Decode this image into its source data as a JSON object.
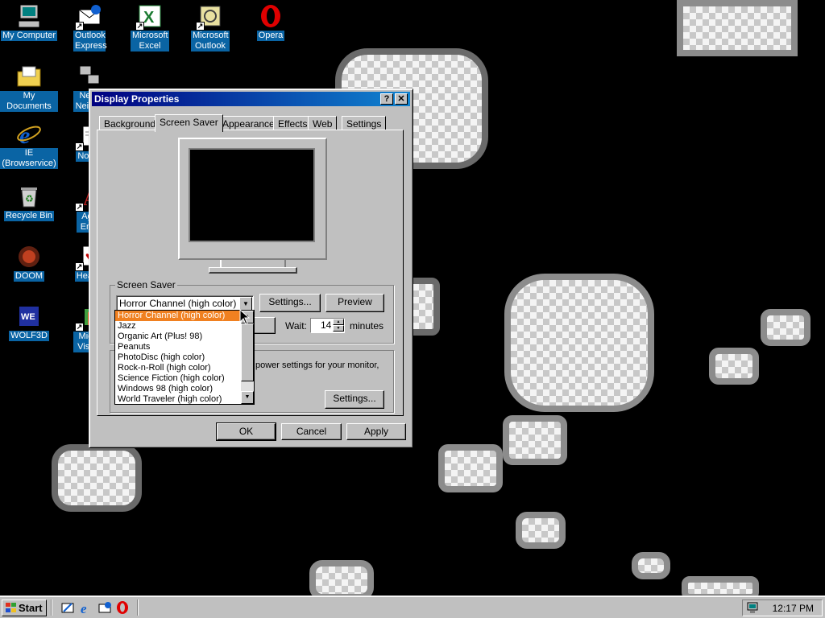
{
  "desktop": {
    "icons": [
      {
        "label": "My Computer",
        "icon": "my-computer-icon"
      },
      {
        "label": "Outlook Express",
        "icon": "outlook-express-icon"
      },
      {
        "label": "Microsoft Excel",
        "icon": "excel-icon"
      },
      {
        "label": "Microsoft Outlook",
        "icon": "outlook-icon"
      },
      {
        "label": "Opera",
        "icon": "opera-icon"
      },
      {
        "label": "My Documents",
        "icon": "my-documents-icon"
      },
      {
        "label": "Netw Neighb",
        "icon": "network-neighborhood-icon"
      },
      {
        "label": "IE (Browservice)",
        "icon": "internet-explorer-icon"
      },
      {
        "label": "Notep",
        "icon": "notepad-icon"
      },
      {
        "label": "Recycle Bin",
        "icon": "recycle-bin-icon"
      },
      {
        "label": "Age Emp",
        "icon": "age-of-empires-icon"
      },
      {
        "label": "DOOM",
        "icon": "doom-icon"
      },
      {
        "label": "Hearts",
        "icon": "hearts-icon"
      },
      {
        "label": "WOLF3D",
        "icon": "wolf3d-icon"
      },
      {
        "label": "Micro Visual",
        "icon": "visual-studio-icon"
      }
    ]
  },
  "dialog": {
    "title": "Display Properties",
    "help_button": "?",
    "close_button": "✕",
    "tabs": [
      "Background",
      "Screen Saver",
      "Appearance",
      "Effects",
      "Web",
      "Settings"
    ],
    "active_tab": "Screen Saver",
    "screen_saver": {
      "group_label": "Screen Saver",
      "selected": "Horror Channel (high color)",
      "settings_button": "Settings...",
      "preview_button": "Preview",
      "wait_label": "Wait:",
      "wait_value": "14",
      "wait_unit": "minutes",
      "dropdown_options": [
        "Horror Channel (high color)",
        "Jazz",
        "Organic Art (Plus! 98)",
        "Peanuts",
        "PhotoDisc (high color)",
        "Rock-n-Roll (high color)",
        "Science Fiction (high color)",
        "Windows 98 (high color)",
        "World Traveler (high color)"
      ],
      "highlighted_option_index": 0
    },
    "energy": {
      "text": "power settings for your monitor,",
      "settings_button": "Settings..."
    },
    "ok_button": "OK",
    "cancel_button": "Cancel",
    "apply_button": "Apply"
  },
  "taskbar": {
    "start_label": "Start",
    "quick_launch": [
      "show-desktop-icon",
      "internet-explorer-icon",
      "outlook-express-icon",
      "opera-icon"
    ],
    "clock": "12:17 PM"
  },
  "colors": {
    "title_bar": "#000080",
    "selection": "#f08020",
    "desktop_label": "#0a64a4"
  }
}
